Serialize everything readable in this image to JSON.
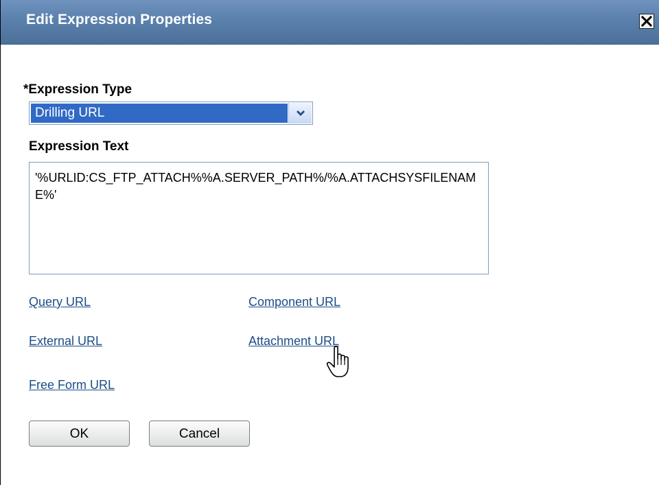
{
  "dialog": {
    "title": "Edit Expression Properties",
    "close_icon": "close-icon"
  },
  "expression_type": {
    "label": "*Expression Type",
    "selected": "Drilling URL",
    "arrow_icon": "chevron-down-icon"
  },
  "expression_text": {
    "label": "Expression Text",
    "value": "'%URLID:CS_FTP_ATTACH%%A.SERVER_PATH%/%A.ATTACHSYSFILENAME%'"
  },
  "links": {
    "query_url": "Query URL",
    "component_url": "Component URL",
    "external_url": "External URL",
    "attachment_url": "Attachment URL",
    "free_form_url": "Free Form URL"
  },
  "buttons": {
    "ok": "OK",
    "cancel": "Cancel"
  },
  "colors": {
    "titlebar": "#5a80ad",
    "selection": "#316ac5",
    "link": "#1c4c88"
  }
}
